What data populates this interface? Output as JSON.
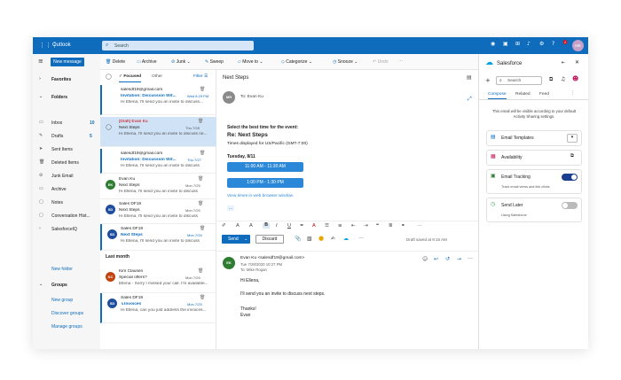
{
  "topbar": {
    "app": "Outlook",
    "search_placeholder": "Search",
    "avatar": "ME",
    "badge": "2"
  },
  "leftnav": {
    "new_message": "New message",
    "favorites": "Favorites",
    "folders": "Folders",
    "items": [
      {
        "label": "Inbox",
        "count": "10"
      },
      {
        "label": "Drafts",
        "count": "5"
      },
      {
        "label": "Sent Items",
        "count": ""
      },
      {
        "label": "Deleted Items",
        "count": ""
      },
      {
        "label": "Junk Email",
        "count": ""
      },
      {
        "label": "Archive",
        "count": ""
      },
      {
        "label": "Notes",
        "count": ""
      },
      {
        "label": "Conversation Hist...",
        "count": ""
      },
      {
        "label": "SalesforceIQ",
        "count": ""
      }
    ],
    "new_folder": "New folder",
    "groups": "Groups",
    "new_group": "New group",
    "discover_groups": "Discover groups",
    "manage_groups": "Manage groups"
  },
  "toolbar": {
    "delete": "Delete",
    "archive": "Archive",
    "junk": "Junk",
    "sweep": "Sweep",
    "move_to": "Move to",
    "categorize": "Categorize",
    "snooze": "Snooze",
    "undo": "Undo"
  },
  "maillist": {
    "focused": "Focused",
    "other": "Other",
    "filter": "Filter",
    "month_label": "Last month",
    "messages": [
      {
        "sender": "salesdf19@gmail.com",
        "subject": "Invitation: Discussion Wit...",
        "date": "Wed 8:29 PM",
        "preview": "Hi Ellena, I'll send you an invite to discuss...",
        "avatar": "",
        "color": ""
      },
      {
        "sender": "[Draft] Evan Ku",
        "subject": "Next Steps",
        "date": "Thu 7/28",
        "preview": "Hi Ellena, I'll send you an invite to discuss ne...",
        "avatar": "",
        "color": ""
      },
      {
        "sender": "salesdf19@gmail.com",
        "subject": "Invitation: Discussion Wit...",
        "date": "Thu 7/27",
        "preview": "Hi Ellena, I'll send you an invite to discuss",
        "avatar": "",
        "color": ""
      },
      {
        "sender": "Evan Ku",
        "subject": "Next Steps",
        "date": "Mon 7/25",
        "preview": "Hi Ellena, I'll send you an invite to discuss",
        "avatar": "EK",
        "color": "#2f7d32"
      },
      {
        "sender": "Sales DF19",
        "subject": "Next Steps",
        "date": "Mon 7/25",
        "preview": "Hi Ellena, I'll send you an invite to discuss",
        "avatar": "SD",
        "color": "#1f4e9e"
      },
      {
        "sender": "Sales DF19",
        "subject": "Next Steps",
        "date": "Mon 7/25",
        "preview": "Hi Ellena, I'll send you an invite to discuss",
        "avatar": "SD",
        "color": "#1f4e9e"
      },
      {
        "sender": "Kim Clausen",
        "subject": "Special offers?",
        "date": "Mon 7/25",
        "preview": "Ellena - Sorry I missed your call. I'm available...",
        "avatar": "KC",
        "color": "#c1440e"
      },
      {
        "sender": "Sales DF19",
        "subject": "Invoices",
        "date": "Mon 7/25",
        "preview": "Hi Ellena, can you just address the invoices...",
        "avatar": "SD",
        "color": "#1f4e9e"
      }
    ]
  },
  "reading": {
    "title": "Next Steps",
    "avatar": "MR",
    "to": "To: Evan Ku",
    "select_time": "Select the best time for the event:",
    "subject": "Re: Next Steps",
    "times_displayed": "Times displayed for US/Pacific (GMT-7:00)",
    "day": "Tuesday, 8/11",
    "slot1": "11:00 AM - 11:30 AM",
    "slot2": "1:00 PM - 1:30 PM",
    "view_times": "View times in web browser window.",
    "ellipsis": "...",
    "send": "Send",
    "discard": "Discard",
    "draft_saved": "Draft saved at 9:15 AM",
    "reply": {
      "avatar": "EK",
      "from": "Evan Ku <salesdf19@gmail.com>",
      "date": "Tue 7/28/2020 10:27 PM",
      "to": "To: Mike Rogan",
      "greeting": "Hi Ellena,",
      "body": "I'll send you an invite to discuss next steps.",
      "thanks": "Thanks!",
      "name": "Evan"
    }
  },
  "salesforce": {
    "title": "Salesforce",
    "search_placeholder": "Search",
    "tabs": [
      "Compose",
      "Related",
      "Feed"
    ],
    "info": "This email will be visible according to your default Activity Sharing settings.",
    "email_templates": "Email Templates",
    "availability": "Availability",
    "email_tracking": "Email Tracking",
    "tracking_sub": "Track email views and link clicks",
    "send_later": "Send Later",
    "send_later_sub": "Using Salesforce"
  },
  "colors": {
    "brand": "#0f6cbd",
    "salesforce": "#00a1e0",
    "tracking": "#2e7d32",
    "pink": "#c2185b"
  }
}
